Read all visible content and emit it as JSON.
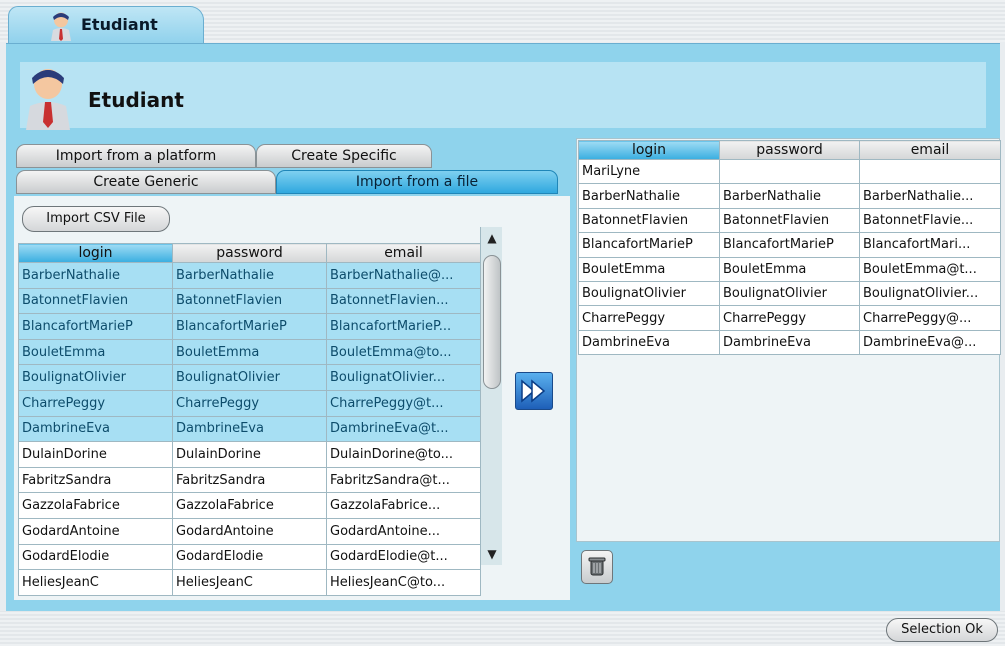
{
  "window": {
    "tab_label": "Etudiant",
    "header_title": "Etudiant"
  },
  "tabs": {
    "row1": [
      "Import from a platform",
      "Create Specific"
    ],
    "row2": [
      "Create Generic",
      "Import from a file"
    ],
    "active": "Import from a file"
  },
  "import_button_label": "Import CSV File",
  "source_table": {
    "columns": [
      "login",
      "password",
      "email"
    ],
    "rows": [
      {
        "login": "BarberNathalie",
        "password": "BarberNathalie",
        "email": "BarberNathalie@...",
        "selected": true
      },
      {
        "login": "BatonnetFlavien",
        "password": "BatonnetFlavien",
        "email": "BatonnetFlavien...",
        "selected": true
      },
      {
        "login": "BlancafortMarieP",
        "password": "BlancafortMarieP",
        "email": "BlancafortMarieP...",
        "selected": true
      },
      {
        "login": "BouletEmma",
        "password": "BouletEmma",
        "email": "BouletEmma@to...",
        "selected": true
      },
      {
        "login": "BoulignatOlivier",
        "password": "BoulignatOlivier",
        "email": "BoulignatOlivier...",
        "selected": true
      },
      {
        "login": "CharrePeggy",
        "password": "CharrePeggy",
        "email": "CharrePeggy@t...",
        "selected": true
      },
      {
        "login": "DambrineEva",
        "password": "DambrineEva",
        "email": "DambrineEva@t...",
        "selected": true
      },
      {
        "login": "DulainDorine",
        "password": "DulainDorine",
        "email": "DulainDorine@to...",
        "selected": false
      },
      {
        "login": "FabritzSandra",
        "password": "FabritzSandra",
        "email": "FabritzSandra@t...",
        "selected": false
      },
      {
        "login": "GazzolaFabrice",
        "password": "GazzolaFabrice",
        "email": "GazzolaFabrice...",
        "selected": false
      },
      {
        "login": "GodardAntoine",
        "password": "GodardAntoine",
        "email": "GodardAntoine...",
        "selected": false
      },
      {
        "login": "GodardElodie",
        "password": "GodardElodie",
        "email": "GodardElodie@t...",
        "selected": false
      },
      {
        "login": "HeliesJeanC",
        "password": "HeliesJeanC",
        "email": "HeliesJeanC@to...",
        "selected": false
      }
    ]
  },
  "dest_table": {
    "columns": [
      "login",
      "password",
      "email"
    ],
    "rows": [
      {
        "login": "MariLyne",
        "password": "",
        "email": ""
      },
      {
        "login": "BarberNathalie",
        "password": "BarberNathalie",
        "email": "BarberNathalie..."
      },
      {
        "login": "BatonnetFlavien",
        "password": "BatonnetFlavien",
        "email": "BatonnetFlavie..."
      },
      {
        "login": "BlancafortMarieP",
        "password": "BlancafortMarieP",
        "email": "BlancafortMari..."
      },
      {
        "login": "BouletEmma",
        "password": "BouletEmma",
        "email": "BouletEmma@t..."
      },
      {
        "login": "BoulignatOlivier",
        "password": "BoulignatOlivier",
        "email": "BoulignatOlivier..."
      },
      {
        "login": "CharrePeggy",
        "password": "CharrePeggy",
        "email": "CharrePeggy@..."
      },
      {
        "login": "DambrineEva",
        "password": "DambrineEva",
        "email": "DambrineEva@..."
      }
    ]
  },
  "icons": {
    "avatar": "student-avatar-icon",
    "transfer": "double-arrow-right-icon",
    "delete": "trash-icon"
  },
  "colors": {
    "panel_blue": "#8fd3ec",
    "selection": "#a7dff3",
    "active_tab": "#2fa8df"
  },
  "selection_ok_label": "Selection Ok"
}
